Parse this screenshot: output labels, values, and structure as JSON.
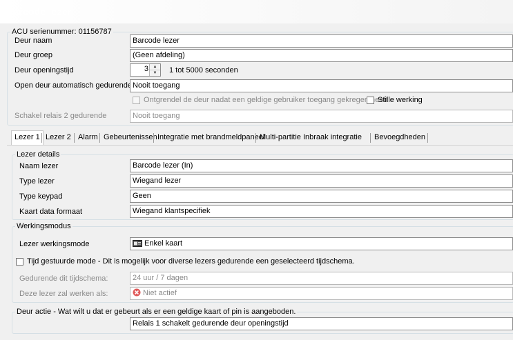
{
  "window": {
    "title": "Barcode lezer"
  },
  "acu": {
    "legend": "ACU serienummer: 01156787",
    "door_name": {
      "label": "Deur naam",
      "value": "Barcode lezer"
    },
    "door_group": {
      "label": "Deur groep",
      "value": "(Geen afdeling)"
    },
    "door_open_time": {
      "label": "Deur openingstijd",
      "value": "3",
      "range": "1 tot 5000 seconden"
    },
    "auto_open": {
      "label": "Open deur automatisch gedurende",
      "value": "Nooit toegang"
    },
    "unlock_after_access": {
      "label": "Ontgrendel de deur nadat een geldige gebruiker toegang gekregen heeft"
    },
    "silent": {
      "label": "Stille werking"
    },
    "relay2": {
      "label": "Schakel relais 2 gedurende",
      "value": "Nooit toegang"
    }
  },
  "tabs": [
    {
      "label": "Lezer 1"
    },
    {
      "label": "Lezer 2"
    },
    {
      "label": "Alarm"
    },
    {
      "label": "Gebeurtenissen"
    },
    {
      "label": "Integratie met brandmeldpaneel"
    },
    {
      "label": "Multi-partitie Inbraak integratie"
    },
    {
      "label": "Bevoegdheden"
    }
  ],
  "reader_details": {
    "legend": "Lezer details",
    "name": {
      "label": "Naam lezer",
      "value": "Barcode lezer (In)"
    },
    "type": {
      "label": "Type lezer",
      "value": "Wiegand lezer"
    },
    "keypad": {
      "label": "Type keypad",
      "value": "Geen"
    },
    "card_format": {
      "label": "Kaart data formaat",
      "value": "Wiegand klantspecifiek"
    }
  },
  "operating_mode": {
    "legend": "Werkingsmodus",
    "mode": {
      "label": "Lezer werkingsmode",
      "value": "Enkel kaart"
    },
    "time_controlled": {
      "label": "Tijd gestuurde mode - Dit is mogelijk voor diverse lezers gedurende een geselecteerd tijdschema."
    },
    "schedule": {
      "label": "Gedurende dit tijdschema:",
      "value": "24 uur / 7 dagen"
    },
    "works_as": {
      "label": "Deze lezer zal werken als:",
      "value": "Niet actief"
    }
  },
  "door_action": {
    "legend": "Deur actie - Wat wilt u dat er gebeurt als er een geldige kaart of pin is aangeboden.",
    "value": "Relais 1 schakelt gedurende deur openingstijd"
  },
  "colors": {
    "fieldset_border": "#d5dfe5",
    "panel_bg": "#f0f0f0",
    "disabled_text": "#8a8a8a"
  },
  "icons": {
    "mode_icon": "card-icon",
    "inactive_icon": "red-x-circle-icon"
  }
}
